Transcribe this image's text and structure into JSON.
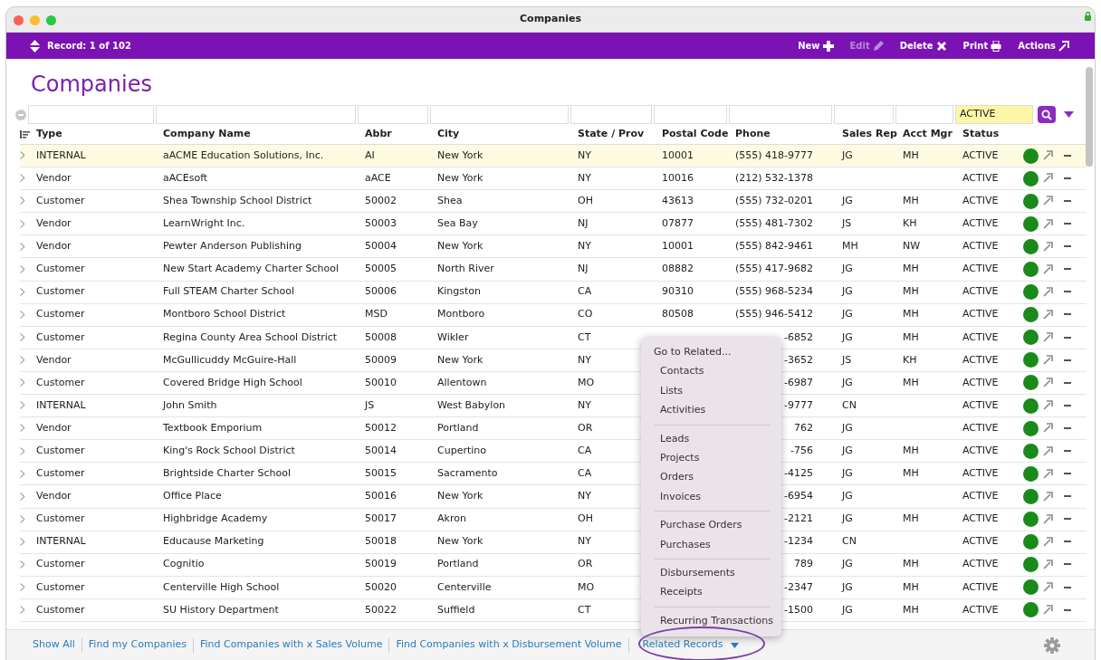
{
  "window": {
    "title": "Companies"
  },
  "toolbar": {
    "record": "Record: 1 of 102",
    "actions": [
      {
        "label": "New",
        "kind": "new",
        "disabled": false
      },
      {
        "label": "Edit",
        "kind": "edit",
        "disabled": true
      },
      {
        "label": "Delete",
        "kind": "delete",
        "disabled": false
      },
      {
        "label": "Print",
        "kind": "print",
        "disabled": false
      },
      {
        "label": "Actions",
        "kind": "actions",
        "disabled": false
      }
    ]
  },
  "heading": "Companies",
  "filters": {
    "status": "ACTIVE"
  },
  "columns": [
    "Type",
    "Company Name",
    "Abbr",
    "City",
    "State / Prov",
    "Postal Code",
    "Phone",
    "Sales Rep",
    "Acct Mgr",
    "Status"
  ],
  "rows": [
    {
      "selected": true,
      "type": "INTERNAL",
      "name": "aACME Education Solutions, Inc.",
      "abbr": "AI",
      "city": "New York",
      "state": "NY",
      "postal": "10001",
      "phone": "(555) 418-9777",
      "rep": "JG",
      "mgr": "MH",
      "status": "ACTIVE"
    },
    {
      "selected": false,
      "type": "Vendor",
      "name": "aACEsoft",
      "abbr": "aACE",
      "city": "New York",
      "state": "NY",
      "postal": "10016",
      "phone": "(212) 532-1378",
      "status": "ACTIVE"
    },
    {
      "selected": false,
      "type": "Customer",
      "name": "Shea Township School District",
      "abbr": "50002",
      "city": "Shea",
      "state": "OH",
      "postal": "43613",
      "phone": "(555) 732-0201",
      "rep": "JG",
      "mgr": "MH",
      "status": "ACTIVE"
    },
    {
      "selected": false,
      "type": "Vendor",
      "name": "LearnWright Inc.",
      "abbr": "50003",
      "city": "Sea Bay",
      "state": "NJ",
      "postal": "07877",
      "phone": "(555) 481-7302",
      "rep": "JS",
      "mgr": "KH",
      "status": "ACTIVE"
    },
    {
      "selected": false,
      "type": "Vendor",
      "name": "Pewter Anderson Publishing",
      "abbr": "50004",
      "city": "New York",
      "state": "NY",
      "postal": "10001",
      "phone": "(555) 842-9461",
      "rep": "MH",
      "mgr": "NW",
      "status": "ACTIVE"
    },
    {
      "selected": false,
      "type": "Customer",
      "name": "New Start Academy Charter School",
      "abbr": "50005",
      "city": "North River",
      "state": "NJ",
      "postal": "08882",
      "phone": "(555) 417-9682",
      "rep": "JG",
      "mgr": "MH",
      "status": "ACTIVE"
    },
    {
      "selected": false,
      "type": "Customer",
      "name": "Full STEAM Charter School",
      "abbr": "50006",
      "city": "Kingston",
      "state": "CA",
      "postal": "90310",
      "phone": "(555) 968-5234",
      "rep": "JG",
      "mgr": "MH",
      "status": "ACTIVE"
    },
    {
      "selected": false,
      "type": "Customer",
      "name": "Montboro School District",
      "abbr": "MSD",
      "city": "Montboro",
      "state": "CO",
      "postal": "80508",
      "phone": "(555) 946-5412",
      "rep": "JG",
      "mgr": "MH",
      "status": "ACTIVE"
    },
    {
      "selected": false,
      "type": "Customer",
      "name": "Regina County Area School District",
      "abbr": "50008",
      "city": "Wikler",
      "state": "CT",
      "phone": "-6852",
      "rep": "JG",
      "mgr": "MH",
      "status": "ACTIVE"
    },
    {
      "selected": false,
      "type": "Vendor",
      "name": "McGullicuddy McGuire-Hall",
      "abbr": "50009",
      "city": "New York",
      "state": "NY",
      "phone": "-3652",
      "rep": "JS",
      "mgr": "KH",
      "status": "ACTIVE"
    },
    {
      "selected": false,
      "type": "Customer",
      "name": "Covered Bridge High School",
      "abbr": "50010",
      "city": "Allentown",
      "state": "MO",
      "phone": "-6987",
      "rep": "JG",
      "mgr": "MH",
      "status": "ACTIVE"
    },
    {
      "selected": false,
      "type": "INTERNAL",
      "name": "John Smith",
      "abbr": "JS",
      "city": "West Babylon",
      "state": "NY",
      "phone": "-9777",
      "rep": "CN",
      "status": "ACTIVE"
    },
    {
      "selected": false,
      "type": "Vendor",
      "name": "Textbook Emporium",
      "abbr": "50012",
      "city": "Portland",
      "state": "OR",
      "phone": "762",
      "rep": "JG",
      "status": "ACTIVE"
    },
    {
      "selected": false,
      "type": "Customer",
      "name": "King's Rock School District",
      "abbr": "50014",
      "city": "Cupertino",
      "state": "CA",
      "phone": "-756",
      "rep": "JG",
      "mgr": "MH",
      "status": "ACTIVE"
    },
    {
      "selected": false,
      "type": "Customer",
      "name": "Brightside Charter School",
      "abbr": "50015",
      "city": "Sacramento",
      "state": "CA",
      "phone": "-4125",
      "rep": "JG",
      "mgr": "MH",
      "status": "ACTIVE"
    },
    {
      "selected": false,
      "type": "Vendor",
      "name": "Office Place",
      "abbr": "50016",
      "city": "New York",
      "state": "NY",
      "phone": "-6954",
      "rep": "JG",
      "status": "ACTIVE"
    },
    {
      "selected": false,
      "type": "Customer",
      "name": "Highbridge Academy",
      "abbr": "50017",
      "city": "Akron",
      "state": "OH",
      "phone": "-2121",
      "rep": "JG",
      "mgr": "MH",
      "status": "ACTIVE"
    },
    {
      "selected": false,
      "type": "INTERNAL",
      "name": "Educause Marketing",
      "abbr": "50018",
      "city": "New York",
      "state": "NY",
      "phone": "-1234",
      "rep": "CN",
      "status": "ACTIVE"
    },
    {
      "selected": false,
      "type": "Customer",
      "name": "Cognitio",
      "abbr": "50019",
      "city": "Portland",
      "state": "OR",
      "phone": "789",
      "rep": "JG",
      "mgr": "MH",
      "status": "ACTIVE"
    },
    {
      "selected": false,
      "type": "Customer",
      "name": "Centerville High School",
      "abbr": "50020",
      "city": "Centerville",
      "state": "MO",
      "phone": "-2347",
      "rep": "JG",
      "mgr": "MH",
      "status": "ACTIVE"
    },
    {
      "selected": false,
      "type": "Customer",
      "name": "SU History Department",
      "abbr": "50022",
      "city": "Suffield",
      "state": "CT",
      "phone": "-1500",
      "rep": "JG",
      "mgr": "MH",
      "status": "ACTIVE"
    }
  ],
  "footer": {
    "links": [
      "Show All",
      "Find my Companies",
      "Find Companies with x Sales Volume",
      "Find Companies with x Disbursement Volume"
    ],
    "menu_button": "Related Records"
  },
  "menu": {
    "title": "Go to Related...",
    "groups": [
      [
        "Contacts",
        "Lists",
        "Activities"
      ],
      [
        "Leads",
        "Projects",
        "Orders",
        "Invoices"
      ],
      [
        "Purchase Orders",
        "Purchases"
      ],
      [
        "Disbursements",
        "Receipts"
      ],
      [
        "Recurring Transactions"
      ]
    ]
  }
}
